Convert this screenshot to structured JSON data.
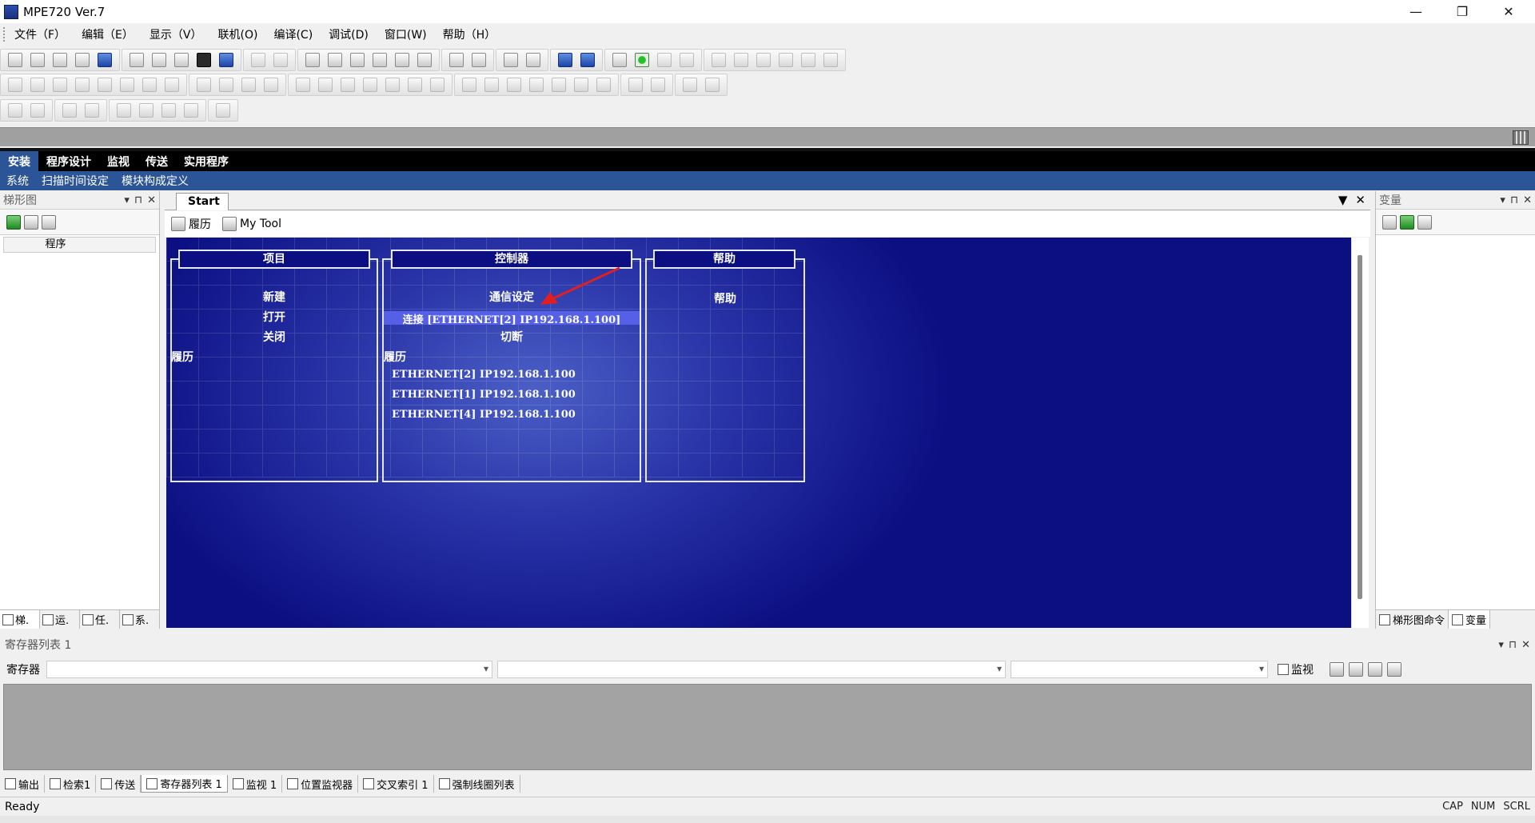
{
  "window": {
    "title": "MPE720 Ver.7",
    "minimize_icon": "—",
    "maximize_icon": "❐",
    "close_icon": "✕"
  },
  "menu": [
    "文件（F）",
    "编辑（E）",
    "显示（V）",
    "联机(O)",
    "编译(C)",
    "调试(D)",
    "窗口(W)",
    "帮助（H）"
  ],
  "ribbon": {
    "tabs": [
      "安装",
      "程序设计",
      "监视",
      "传送",
      "实用程序"
    ],
    "active_tab": "安装",
    "subitems": [
      "系统",
      "扫描时间设定",
      "模块构成定义"
    ]
  },
  "left_panel": {
    "title": "梯形图",
    "column_header": "程序",
    "bottom_tabs": [
      "梯.",
      "运.",
      "任.",
      "系."
    ]
  },
  "panel_ctrl_icons": {
    "dropdown": "▾",
    "pin": "⊓",
    "close": "✕"
  },
  "document": {
    "tab": "Start",
    "tab_menu_icon": "▼",
    "tab_close_icon": "✕",
    "toolbar": [
      "履历",
      "My Tool"
    ]
  },
  "start_page": {
    "project": {
      "title": "项目",
      "links": [
        "新建",
        "打开",
        "关闭"
      ],
      "history_label": "履历"
    },
    "controller": {
      "title": "控制器",
      "comm_settings": "通信设定",
      "connect": "连接 [ETHERNET[2] IP192.168.1.100]",
      "disconnect": "切断",
      "history_label": "履历",
      "history": [
        "ETHERNET[2] IP192.168.1.100",
        "ETHERNET[1] IP192.168.1.100",
        "ETHERNET[4] IP192.168.1.100"
      ]
    },
    "help": {
      "title": "帮助",
      "links": [
        "帮助"
      ]
    },
    "colors": {
      "background": "#0b0f82",
      "highlight": "#5560e6",
      "arrow": "#e02020"
    }
  },
  "right_panel": {
    "title": "变量",
    "bottom_tabs": [
      "梯形图命令",
      "变量"
    ]
  },
  "register_panel": {
    "title": "寄存器列表 1",
    "label": "寄存器",
    "monitor_label": "监视"
  },
  "bottom_tabs": [
    "输出",
    "检索1",
    "传送",
    "寄存器列表 1",
    "监视 1",
    "位置监视器",
    "交叉索引 1",
    "强制线圈列表"
  ],
  "bottom_tabs_active": "寄存器列表 1",
  "status": {
    "text": "Ready",
    "indicators": [
      "CAP",
      "NUM",
      "SCRL"
    ]
  }
}
